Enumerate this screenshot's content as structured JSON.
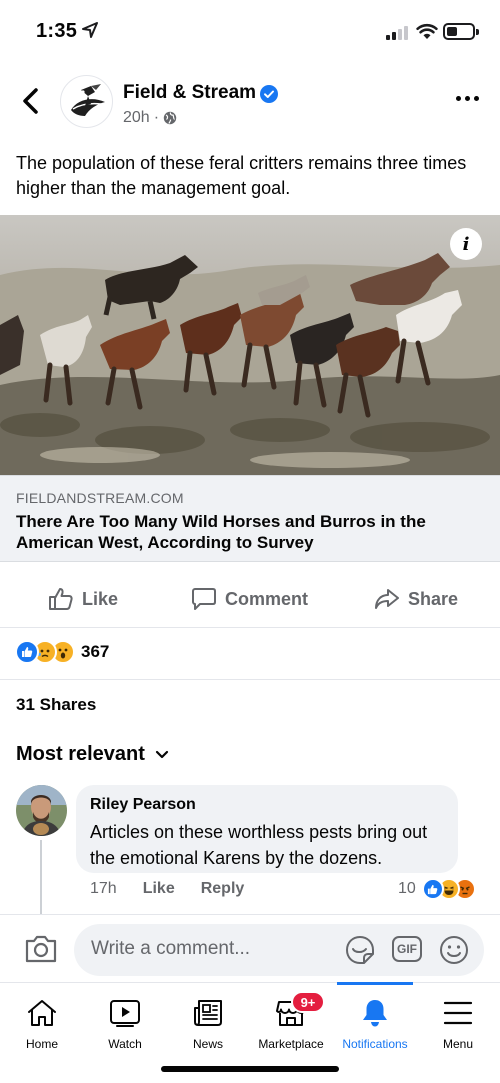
{
  "status_bar": {
    "time": "1:35"
  },
  "post": {
    "page_name": "Field & Stream",
    "time_ago": "20h",
    "separator": "·",
    "text": "The population of these feral critters remains three times higher than the management goal.",
    "link": {
      "domain": "FIELDANDSTREAM.COM",
      "title": "There Are Too Many Wild Horses and Burros in the American West, According to Survey",
      "info_label": "i"
    },
    "actions": {
      "like": "Like",
      "comment": "Comment",
      "share": "Share"
    },
    "reaction_count": "367",
    "shares": "31 Shares"
  },
  "comments": {
    "sort_label": "Most relevant",
    "items": [
      {
        "author": "Riley Pearson",
        "text": "Articles on these  worthless pests bring out the emotional Karens by the dozens.",
        "time": "17h",
        "like": "Like",
        "reply": "Reply",
        "reaction_count": "10"
      }
    ]
  },
  "composer": {
    "placeholder": "Write a comment...",
    "gif": "GIF"
  },
  "tabbar": {
    "tabs": [
      {
        "label": "Home",
        "icon": "home-icon"
      },
      {
        "label": "Watch",
        "icon": "watch-icon"
      },
      {
        "label": "News",
        "icon": "news-icon"
      },
      {
        "label": "Marketplace",
        "icon": "marketplace-icon",
        "badge": "9+"
      },
      {
        "label": "Notifications",
        "icon": "bell-icon",
        "active": true
      },
      {
        "label": "Menu",
        "icon": "menu-icon"
      }
    ]
  },
  "colors": {
    "accent": "#1877f2",
    "badge": "#e41e3f",
    "secondary_text": "#65676b"
  }
}
